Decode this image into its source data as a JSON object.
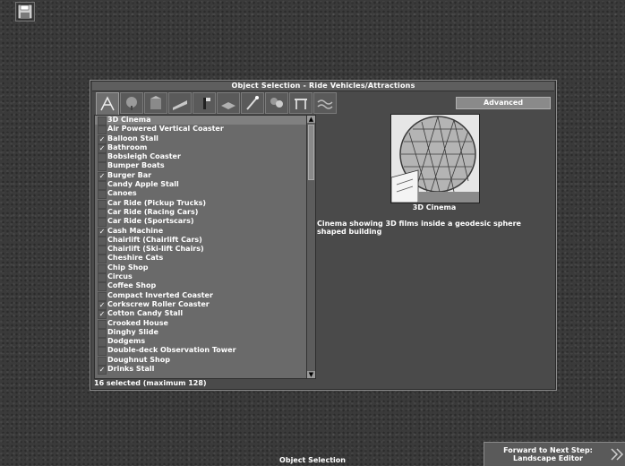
{
  "toolbar": {
    "save_icon": "floppy-disk-icon"
  },
  "window": {
    "title": "Object Selection - Ride Vehicles/Attractions",
    "tabs": [
      {
        "icon": "ride-vehicles-icon",
        "active": true
      },
      {
        "icon": "scenery-trees-icon"
      },
      {
        "icon": "scenery-small-icon"
      },
      {
        "icon": "scenery-large-icon"
      },
      {
        "icon": "scenery-walls-icon"
      },
      {
        "icon": "footpath-icon"
      },
      {
        "icon": "footpath-items-icon"
      },
      {
        "icon": "scenery-group-icon"
      },
      {
        "icon": "park-entrance-icon"
      },
      {
        "icon": "water-icon"
      }
    ],
    "advanced_label": "Advanced"
  },
  "list": {
    "items": [
      {
        "label": "3D Cinema",
        "checked": false,
        "selected": true
      },
      {
        "label": "Air Powered Vertical Coaster",
        "checked": false
      },
      {
        "label": "Balloon Stall",
        "checked": true
      },
      {
        "label": "Bathroom",
        "checked": true
      },
      {
        "label": "Bobsleigh Coaster",
        "checked": false
      },
      {
        "label": "Bumper Boats",
        "checked": false
      },
      {
        "label": "Burger Bar",
        "checked": true
      },
      {
        "label": "Candy Apple Stall",
        "checked": false
      },
      {
        "label": "Canoes",
        "checked": false
      },
      {
        "label": "Car Ride (Pickup Trucks)",
        "checked": false
      },
      {
        "label": "Car Ride (Racing Cars)",
        "checked": false
      },
      {
        "label": "Car Ride (Sportscars)",
        "checked": false
      },
      {
        "label": "Cash Machine",
        "checked": true
      },
      {
        "label": "Chairlift (Chairlift Cars)",
        "checked": false
      },
      {
        "label": "Chairlift (Ski-lift Chairs)",
        "checked": false
      },
      {
        "label": "Cheshire Cats",
        "checked": false
      },
      {
        "label": "Chip Shop",
        "checked": false
      },
      {
        "label": "Circus",
        "checked": false
      },
      {
        "label": "Coffee Shop",
        "checked": false
      },
      {
        "label": "Compact Inverted Coaster",
        "checked": false
      },
      {
        "label": "Corkscrew Roller Coaster",
        "checked": true
      },
      {
        "label": "Cotton Candy Stall",
        "checked": true
      },
      {
        "label": "Crooked House",
        "checked": false
      },
      {
        "label": "Dinghy Slide",
        "checked": false
      },
      {
        "label": "Dodgems",
        "checked": false
      },
      {
        "label": "Double-deck Observation Tower",
        "checked": false
      },
      {
        "label": "Doughnut Shop",
        "checked": false
      },
      {
        "label": "Drinks Stall",
        "checked": true
      }
    ]
  },
  "status": {
    "selected_count": "16 selected (maximum 128)"
  },
  "preview": {
    "name": "3D Cinema",
    "description": "Cinema showing 3D films inside a geodesic sphere shaped building"
  },
  "footer": {
    "label": "Object Selection",
    "next_step_line1": "Forward to Next Step:",
    "next_step_line2": "Landscape Editor",
    "next_icon": "double-chevron-right-icon"
  }
}
